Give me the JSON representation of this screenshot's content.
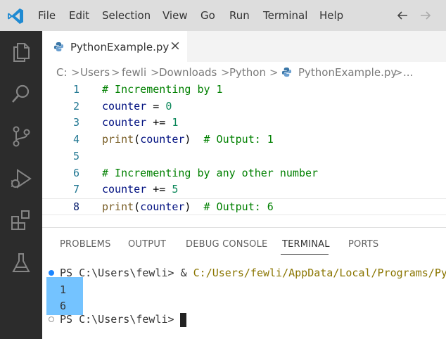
{
  "titlebar": {
    "menu": [
      "File",
      "Edit",
      "Selection",
      "View",
      "Go",
      "Run",
      "Terminal",
      "Help"
    ],
    "back_icon": "arrow-left-icon",
    "forward_icon": "arrow-right-icon"
  },
  "activity_bar": {
    "items": [
      "explorer-icon",
      "search-icon",
      "source-control-icon",
      "run-debug-icon",
      "extensions-icon",
      "testing-icon"
    ]
  },
  "tab": {
    "label": "PythonExample.py",
    "close_glyph": "×"
  },
  "breadcrumb": {
    "items": [
      "C:",
      "Users",
      "fewli",
      "Downloads",
      "Python",
      "PythonExample.py",
      "..."
    ],
    "sep": ">"
  },
  "editor": {
    "current_line": 8,
    "lines": [
      {
        "n": "1",
        "tokens": [
          {
            "t": "# Incrementing by 1",
            "c": "comment"
          }
        ]
      },
      {
        "n": "2",
        "tokens": [
          {
            "t": "counter",
            "c": "var"
          },
          {
            "t": " = ",
            "c": "op"
          },
          {
            "t": "0",
            "c": "num"
          }
        ]
      },
      {
        "n": "3",
        "tokens": [
          {
            "t": "counter",
            "c": "var"
          },
          {
            "t": " += ",
            "c": "op"
          },
          {
            "t": "1",
            "c": "num"
          }
        ]
      },
      {
        "n": "4",
        "tokens": [
          {
            "t": "print",
            "c": "fn"
          },
          {
            "t": "(",
            "c": "punc"
          },
          {
            "t": "counter",
            "c": "var"
          },
          {
            "t": ")  ",
            "c": "punc"
          },
          {
            "t": "# Output: 1",
            "c": "comment"
          }
        ]
      },
      {
        "n": "5",
        "tokens": []
      },
      {
        "n": "6",
        "tokens": [
          {
            "t": "# Incrementing by any other number",
            "c": "comment"
          }
        ]
      },
      {
        "n": "7",
        "tokens": [
          {
            "t": "counter",
            "c": "var"
          },
          {
            "t": " += ",
            "c": "op"
          },
          {
            "t": "5",
            "c": "num"
          }
        ]
      },
      {
        "n": "8",
        "tokens": [
          {
            "t": "print",
            "c": "fn"
          },
          {
            "t": "(",
            "c": "punc"
          },
          {
            "t": "counter",
            "c": "var"
          },
          {
            "t": ")  ",
            "c": "punc"
          },
          {
            "t": "# Output: 6",
            "c": "comment"
          }
        ]
      }
    ]
  },
  "panel": {
    "tabs": [
      "PROBLEMS",
      "OUTPUT",
      "DEBUG CONSOLE",
      "TERMINAL",
      "PORTS"
    ],
    "active_tab": "TERMINAL"
  },
  "terminal": {
    "prompt1": "PS C:\\Users\\fewli> ",
    "command_amp": "& ",
    "command_path": "C:/Users/fewli/AppData/Local/Programs/Py",
    "output1": "1",
    "output2": "6",
    "prompt2": "PS C:\\Users\\fewli> "
  },
  "colors": {
    "accent": "#1a85ff",
    "selection": "#5cb8ff",
    "activity_bar": "#2c2c2c",
    "titlebar": "#dddddd"
  }
}
